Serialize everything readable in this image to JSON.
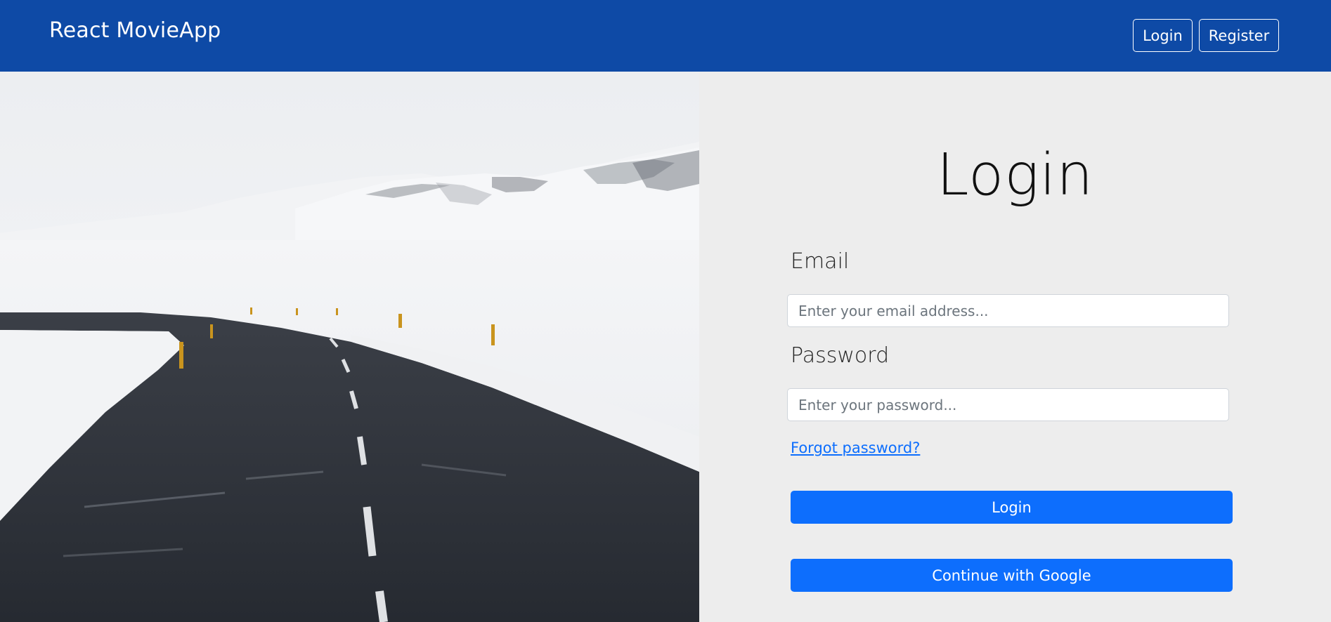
{
  "navbar": {
    "brand": "React MovieApp",
    "login_label": "Login",
    "register_label": "Register",
    "background_color": "#0e4aa6"
  },
  "hero": {
    "image_description_icon": "snowy-road-image"
  },
  "form": {
    "title": "Login",
    "email_label": "Email",
    "email_placeholder": "Enter your email address...",
    "email_value": "",
    "password_label": "Password",
    "password_placeholder": "Enter your password...",
    "password_value": "",
    "forgot_link": "Forgot password?",
    "login_button": "Login",
    "google_button": "Continue with Google",
    "accent_color": "#0d6efd"
  }
}
